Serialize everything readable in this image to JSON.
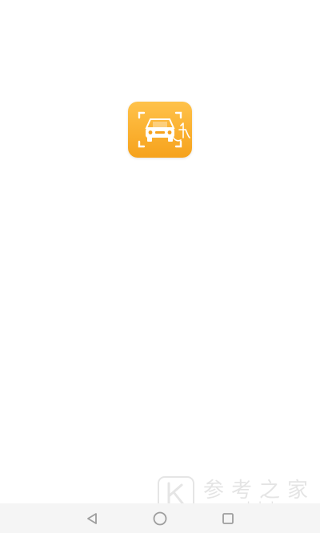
{
  "splash": {
    "app_icon": {
      "icon": "car-scan-icon",
      "colors": {
        "gradient_top": "#ffc24a",
        "gradient_bottom": "#f6a21c",
        "glyph": "#ffffff"
      }
    }
  },
  "watermark": {
    "logo_icon": "k-logo-icon",
    "title": "参考之家",
    "url": "www.ckdzb.com"
  },
  "nav_bar": {
    "back_icon": "back-triangle-icon",
    "home_icon": "home-circle-icon",
    "recents_icon": "recents-square-icon",
    "icon_color": "#9e9e9e"
  }
}
